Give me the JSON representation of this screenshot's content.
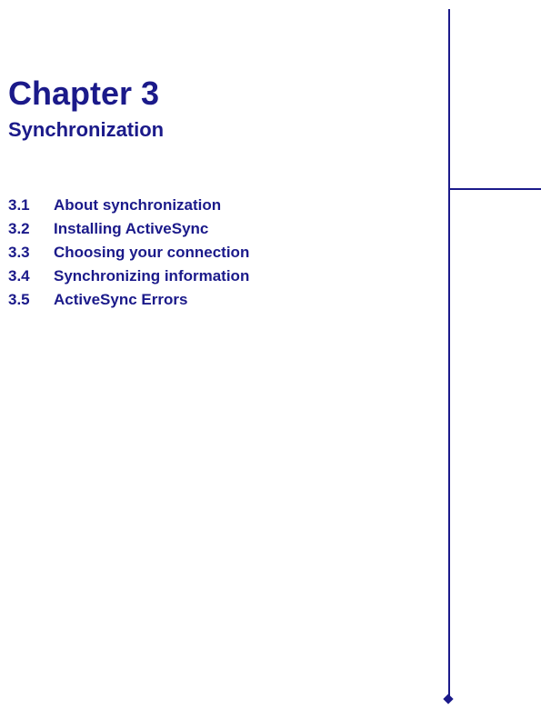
{
  "colors": {
    "primary": "#1b1a8a"
  },
  "chapter": {
    "title": "Chapter 3",
    "subtitle": "Synchronization"
  },
  "toc": {
    "items": [
      {
        "num": "3.1",
        "label": "About synchronization"
      },
      {
        "num": "3.2",
        "label": "Installing ActiveSync"
      },
      {
        "num": "3.3",
        "label": "Choosing your connection"
      },
      {
        "num": "3.4",
        "label": "Synchronizing information"
      },
      {
        "num": "3.5",
        "label": "ActiveSync Errors"
      }
    ]
  }
}
